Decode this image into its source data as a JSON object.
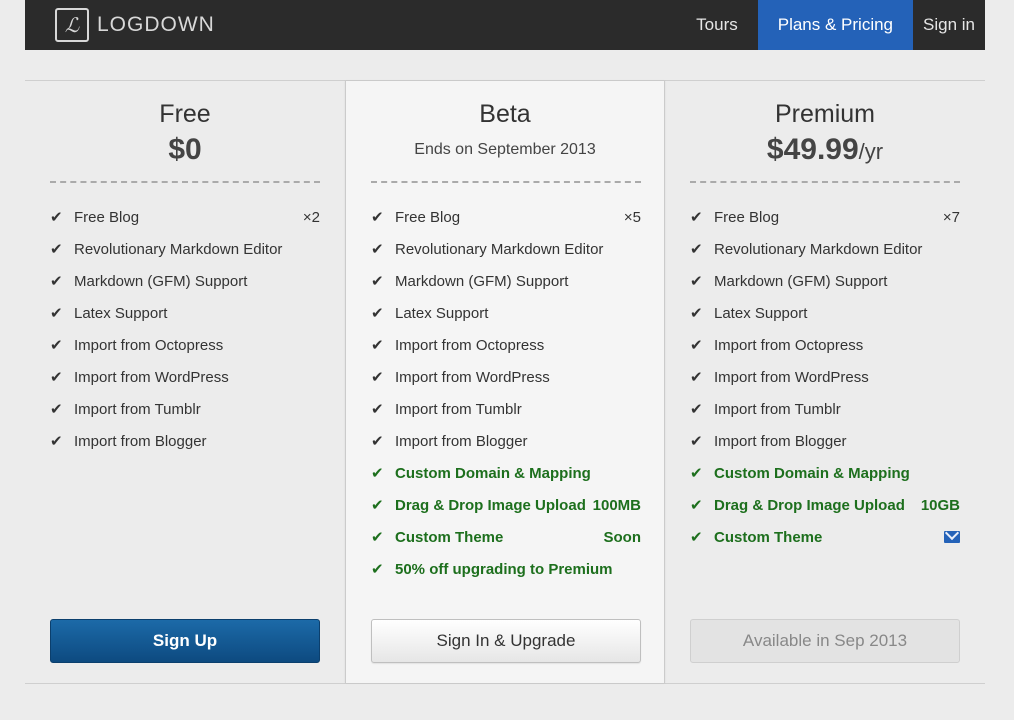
{
  "header": {
    "logo_mark": "ℒ",
    "logo_text": "LOGDOWN",
    "nav": [
      {
        "label": "Tours",
        "active": false
      },
      {
        "label": "Plans & Pricing",
        "active": true
      },
      {
        "label": "Sign in",
        "active": false
      }
    ]
  },
  "colors": {
    "topbar": "#2b2b2b",
    "nav_active": "#2462b8",
    "feature_highlight": "#1d6f1d",
    "primary_button": "#0d4a80"
  },
  "plans": [
    {
      "name": "Free",
      "price": "$0",
      "features": [
        {
          "label": "Free Blog",
          "extra": "×2"
        },
        {
          "label": "Revolutionary Markdown Editor"
        },
        {
          "label": "Markdown (GFM) Support"
        },
        {
          "label": "Latex Support"
        },
        {
          "label": "Import from Octopress"
        },
        {
          "label": "Import from WordPress"
        },
        {
          "label": "Import from Tumblr"
        },
        {
          "label": "Import from Blogger"
        }
      ],
      "button": "Sign Up"
    },
    {
      "name": "Beta",
      "subtitle": "Ends on September 2013",
      "features": [
        {
          "label": "Free Blog",
          "extra": "×5"
        },
        {
          "label": "Revolutionary Markdown Editor"
        },
        {
          "label": "Markdown (GFM) Support"
        },
        {
          "label": "Latex Support"
        },
        {
          "label": "Import from Octopress"
        },
        {
          "label": "Import from WordPress"
        },
        {
          "label": "Import from Tumblr"
        },
        {
          "label": "Import from Blogger"
        },
        {
          "label": "Custom Domain & Mapping",
          "highlight": true
        },
        {
          "label": "Drag & Drop Image Upload",
          "extra": "100MB",
          "highlight": true
        },
        {
          "label": "Custom Theme",
          "extra": "Soon",
          "highlight": true
        },
        {
          "label": "50% off upgrading to Premium",
          "highlight": true
        }
      ],
      "button": "Sign In & Upgrade"
    },
    {
      "name": "Premium",
      "price": "$49.99",
      "price_period": "/yr",
      "features": [
        {
          "label": "Free Blog",
          "extra": "×7"
        },
        {
          "label": "Revolutionary Markdown Editor"
        },
        {
          "label": "Markdown (GFM) Support"
        },
        {
          "label": "Latex Support"
        },
        {
          "label": "Import from Octopress"
        },
        {
          "label": "Import from WordPress"
        },
        {
          "label": "Import from Tumblr"
        },
        {
          "label": "Import from Blogger"
        },
        {
          "label": "Custom Domain & Mapping",
          "highlight": true
        },
        {
          "label": "Drag & Drop Image Upload",
          "extra": "10GB",
          "highlight": true
        },
        {
          "label": "Custom Theme",
          "highlight": true,
          "icon": "envelope-icon"
        }
      ],
      "button": "Available in Sep 2013"
    }
  ]
}
